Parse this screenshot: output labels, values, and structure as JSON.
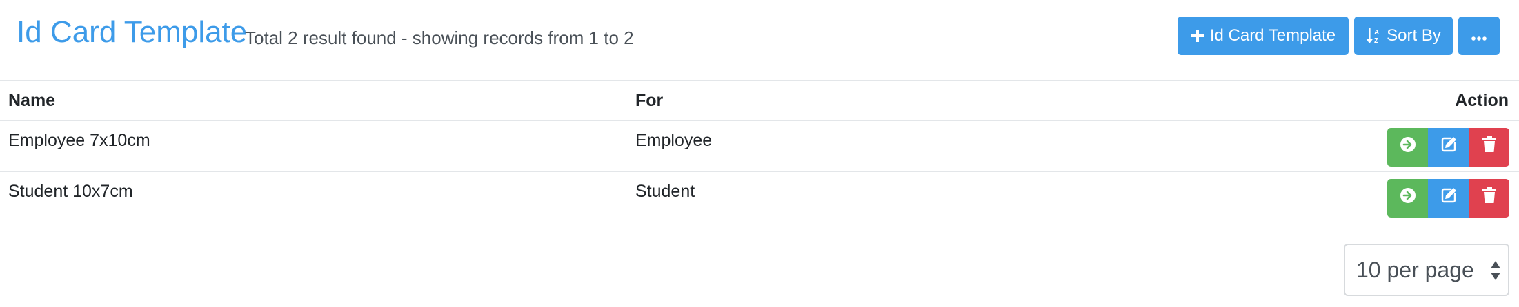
{
  "header": {
    "title": "Id Card Template",
    "subtitle": "Total 2 result found - showing records from 1 to 2"
  },
  "toolbar": {
    "add_label": "Id Card Template",
    "sort_label": "Sort By",
    "more_icon": "more-icon"
  },
  "table": {
    "columns": [
      "Name",
      "For",
      "Action"
    ],
    "rows": [
      {
        "name": "Employee 7x10cm",
        "for": "Employee"
      },
      {
        "name": "Student 10x7cm",
        "for": "Student"
      }
    ]
  },
  "pagination": {
    "per_page": "10 per page"
  },
  "colors": {
    "primary": "#3d9be9",
    "success": "#5cb85c",
    "danger": "#e0414f"
  }
}
